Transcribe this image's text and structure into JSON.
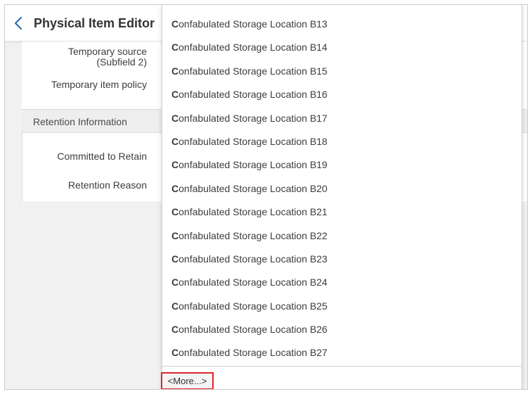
{
  "header": {
    "title": "Physical Item Editor",
    "back_icon": "chevron-left-icon"
  },
  "fields": {
    "temporary_source_line1": "Temporary source",
    "temporary_source_line2": "(Subfield 2)",
    "temporary_item_policy": "Temporary item policy"
  },
  "retention": {
    "section_title": "Retention Information",
    "committed_to_retain": "Committed to Retain",
    "retention_reason": "Retention Reason"
  },
  "dropdown": {
    "options": [
      {
        "first": "C",
        "rest": "onfabulated Storage Location B13"
      },
      {
        "first": "C",
        "rest": "onfabulated Storage Location B14"
      },
      {
        "first": "C",
        "rest": "onfabulated Storage Location B15"
      },
      {
        "first": "C",
        "rest": "onfabulated Storage Location B16"
      },
      {
        "first": "C",
        "rest": "onfabulated Storage Location B17"
      },
      {
        "first": "C",
        "rest": "onfabulated Storage Location B18"
      },
      {
        "first": "C",
        "rest": "onfabulated Storage Location B19"
      },
      {
        "first": "C",
        "rest": "onfabulated Storage Location B20"
      },
      {
        "first": "C",
        "rest": "onfabulated Storage Location B21"
      },
      {
        "first": "C",
        "rest": "onfabulated Storage Location B22"
      },
      {
        "first": "C",
        "rest": "onfabulated Storage Location B23"
      },
      {
        "first": "C",
        "rest": "onfabulated Storage Location B24"
      },
      {
        "first": "C",
        "rest": "onfabulated Storage Location B25"
      },
      {
        "first": "C",
        "rest": "onfabulated Storage Location B26"
      },
      {
        "first": "C",
        "rest": "onfabulated Storage Location B27"
      }
    ],
    "more_label": "<More...>",
    "highlight_color": "#e0272b"
  },
  "colors": {
    "accent": "#2d6fb5"
  }
}
